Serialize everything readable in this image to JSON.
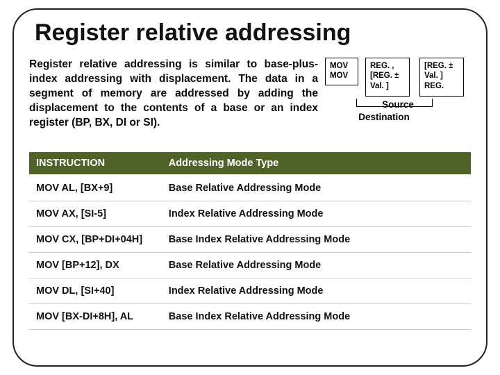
{
  "title": "Register relative addressing",
  "description": "Register relative addressing is similar to base-plus-index addressing with displacement. The data in a segment of memory are addressed by adding the displacement to the contents of a base or an index register (BP, BX, DI or SI).",
  "diagram": {
    "col1": "MOV\nMOV",
    "col2": "REG. ,\n[REG. ±\nVal. ]",
    "col3": "[REG. ±\nVal. ]\nREG.",
    "source_label": "Source",
    "dest_label": "Destination"
  },
  "table": {
    "headers": [
      "INSTRUCTION",
      "Addressing Mode Type"
    ],
    "rows": [
      [
        "MOV AL, [BX+9]",
        "Base Relative Addressing Mode"
      ],
      [
        "MOV AX, [SI-5]",
        "Index Relative Addressing Mode"
      ],
      [
        "MOV CX, [BP+DI+04H]",
        "Base Index Relative Addressing Mode"
      ],
      [
        "MOV [BP+12], DX",
        "Base Relative Addressing Mode"
      ],
      [
        "MOV DL, [SI+40]",
        "Index Relative Addressing Mode"
      ],
      [
        "MOV [BX-DI+8H], AL",
        "Base Index Relative Addressing Mode"
      ]
    ]
  },
  "colors": {
    "header_bg": "#4f6228"
  }
}
